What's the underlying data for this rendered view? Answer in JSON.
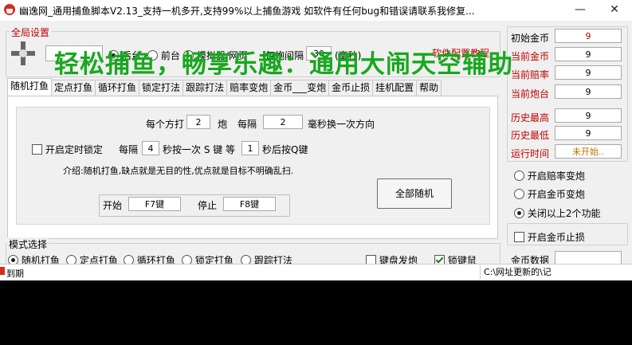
{
  "window": {
    "title": "幽逸网_通用捕鱼脚本V2.13_支持一机多开,支持99%以上捕鱼游戏  如软件有任何bug和错误请联系我修复...",
    "minimize": "—",
    "close": "✕"
  },
  "global": {
    "legend": "全局设置",
    "radio_back": "后台",
    "radio_front": "前台",
    "radio_sim": "模拟器/网页",
    "interval_label": "每炮间隔",
    "interval_value": "30",
    "interval_unit": "(毫秒)",
    "config_link": "软件配置教程"
  },
  "overlay_text": "轻松捕鱼，畅享乐趣：通用大闹天空辅助",
  "tabs": [
    "随机打鱼",
    "定点打鱼",
    "循环打鱼",
    "锁定打法",
    "跟踪打法",
    "赔率变炮",
    "金币___变炮",
    "金币止损",
    "挂机配置",
    "帮助"
  ],
  "random": {
    "per_dir_prefix": "每个方打",
    "per_dir_value": "2",
    "per_dir_unit": "炮",
    "every_label": "每隔",
    "every_value": "2",
    "every_unit": "毫秒换一次方向",
    "timer_lock_label": "开启定时锁定",
    "lock_every": "每隔",
    "lock_value": "4",
    "lock_text": "秒按一次 S 键 等",
    "wait_value": "1",
    "wait_text": "秒后按Q键",
    "intro": "介绍:随机打鱼,缺点就是无目的性,优点就是目标不明确乱扫.",
    "start_label": "开始",
    "start_key": "F7键",
    "stop_label": "停止",
    "stop_key": "F8键",
    "all_random_btn": "全部随机"
  },
  "mode": {
    "legend": "模式选择",
    "items": [
      "随机打鱼",
      "定点打鱼",
      "循环打鱼",
      "锁定打鱼",
      "跟踪打法"
    ],
    "keyboard_fire": "键盘发炮",
    "lock_key": "锁键鼠"
  },
  "stats": {
    "init_gold_label": "初始金币",
    "init_gold_value": "9",
    "cur_gold_label": "当前金币",
    "cur_gold_value": "9",
    "cur_odds_label": "当前赔率",
    "cur_odds_value": "9",
    "cur_cannon_label": "当前炮台",
    "cur_cannon_value": "9",
    "hist_high_label": "历史最高",
    "hist_high_value": "9",
    "hist_low_label": "历史最低",
    "hist_low_value": "9",
    "run_time_label": "运行时间",
    "run_time_value": "未开始..",
    "opt_odds": "开启赔率变炮",
    "opt_gold": "开启金币变炮",
    "opt_off": "关闭以上2个功能",
    "stop_loss": "开启金币止损",
    "gold_data": "金币数据"
  },
  "status": {
    "expire": "到期",
    "path": "C:\\网址更新的\\记"
  }
}
